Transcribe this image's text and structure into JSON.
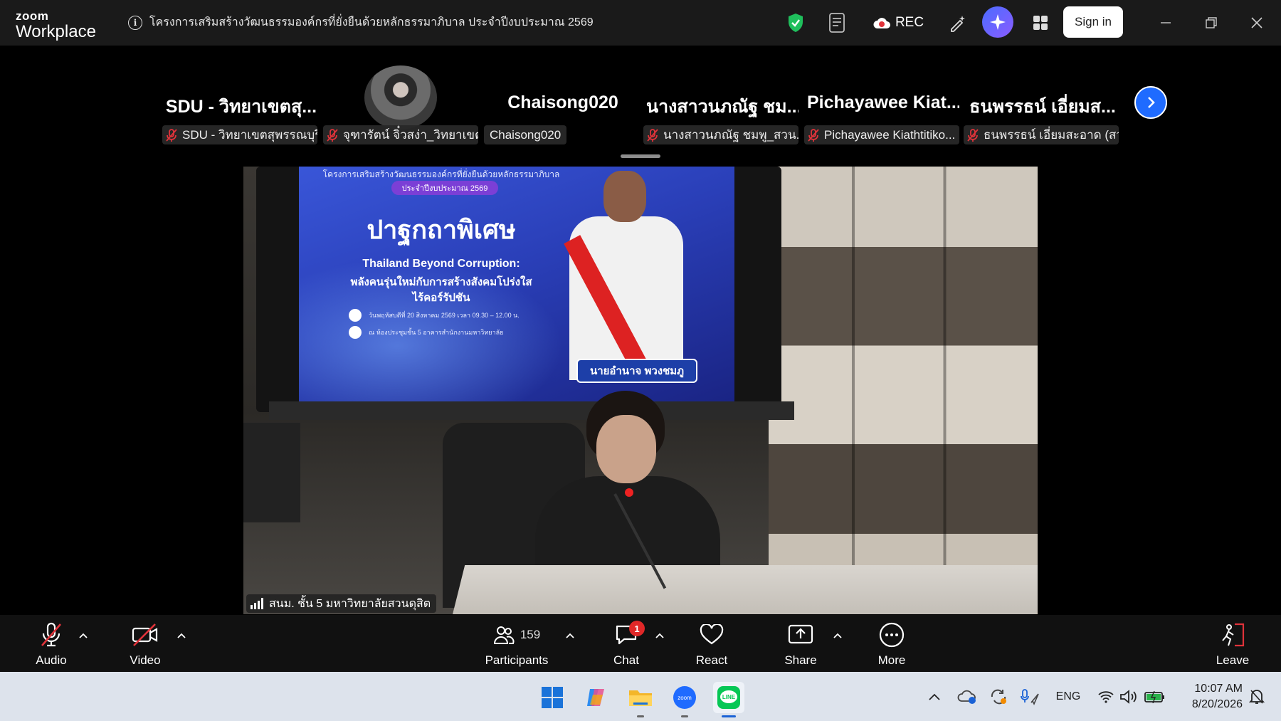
{
  "app": {
    "logo_top": "zoom",
    "logo_bottom": "Workplace",
    "meeting_title": "โครงการเสริมสร้างวัฒนธรรมองค์กรที่ยั่งยืนด้วยหลักธรรมาภิบาล ประจำปีงบประมาณ 2569",
    "rec_label": "REC",
    "sign_in_label": "Sign in"
  },
  "gallery": {
    "tiles": [
      {
        "display": "SDU - วิทยาเขตสุ...",
        "label": "SDU - วิทยาเขตสุพรรณบุรี"
      },
      {
        "display": "",
        "label": "จุฑารัตน์ จิ๋วสง่า_วิทยาเขต..."
      },
      {
        "display": "Chaisong020",
        "label": "Chaisong020"
      },
      {
        "display": "นางสาวนภณัฐ ชม...",
        "label": "นางสาวนภณัฐ ชมพู_สวน..."
      },
      {
        "display": "Pichayawee  Kiat...",
        "label": "Pichayawee Kiathtitiko..."
      },
      {
        "display": "ธนพรรธน์ เอี่ยมส...",
        "label": "ธนพรรธน์ เอี่ยมสะอาด (สว..."
      }
    ]
  },
  "video": {
    "speaker_label": "สนม. ชั้น 5 มหาวิทยาลัยสวนดุสิต",
    "slide": {
      "header": "โครงการเสริมสร้างวัฒนธรรมองค์กรที่ยั่งยืนด้วยหลักธรรมาภิบาล",
      "pill": "ประจำปีงบประมาณ 2569",
      "title": "ปาฐกถาพิเศษ",
      "subtitle1": "Thailand Beyond Corruption:",
      "subtitle2": "พลังคนรุ่นใหม่กับการสร้างสังคมโปร่งใส",
      "subtitle3": "ไร้คอร์รัปชัน",
      "date_line": "วันพฤหัสบดีที่ 20 สิงหาคม 2569 เวลา 09.30 – 12.00 น.",
      "place_line": "ณ ห้องประชุมชั้น 5 อาคารสำนักงานมหาวิทยาลัย",
      "speaker_name": "นายอำนาจ พวงชมภู"
    }
  },
  "toolbar": {
    "audio": "Audio",
    "video": "Video",
    "participants": "Participants",
    "participants_count": "159",
    "chat": "Chat",
    "chat_badge": "1",
    "react": "React",
    "share": "Share",
    "more": "More",
    "leave": "Leave"
  },
  "taskbar": {
    "lang": "ENG",
    "time": "10:07 AM",
    "date": "8/20/2026"
  },
  "colors": {
    "accent_blue": "#1f6bff",
    "muted_red": "#e0333a",
    "shield_green": "#1fbf5c",
    "badge_red": "#e02828"
  }
}
